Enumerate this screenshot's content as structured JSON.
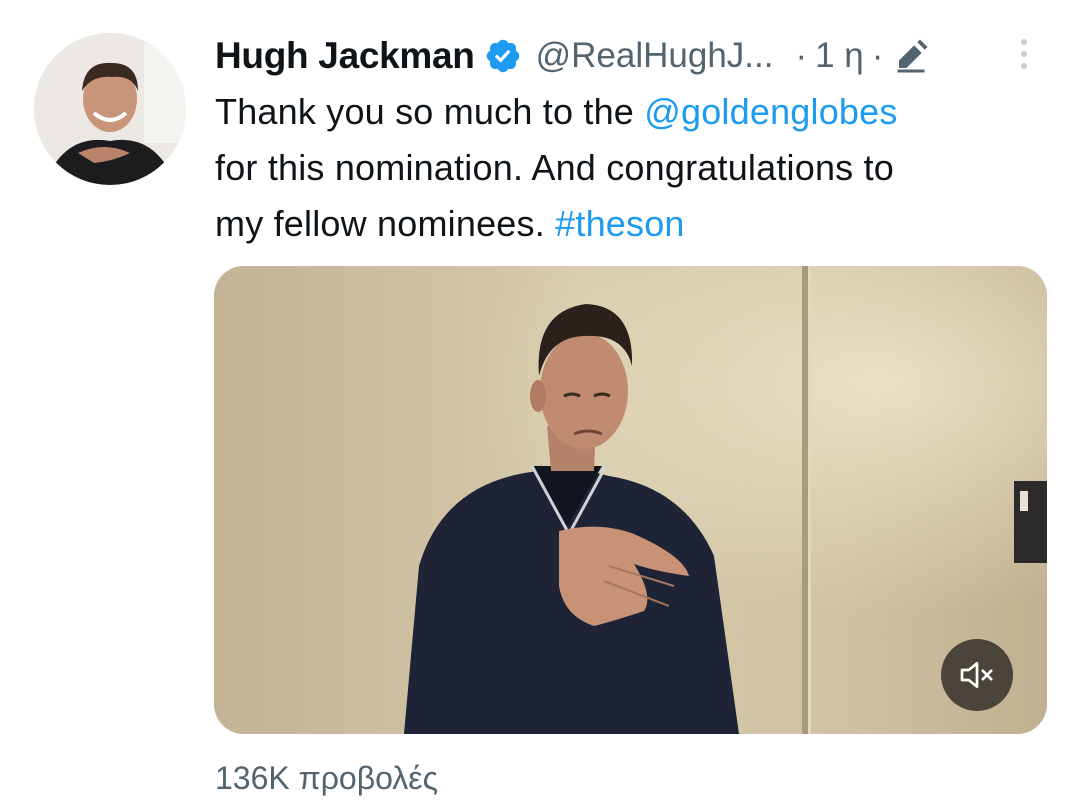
{
  "tweet": {
    "author_name": "Hugh Jackman",
    "handle": "@RealHughJ...",
    "separator": "·",
    "time": "1 η",
    "text_lines": [
      {
        "before": "Thank you so much to the ",
        "link": "@goldenglobes",
        "after": ""
      },
      {
        "before": "for this nomination. And congratulations to",
        "link": "",
        "after": ""
      },
      {
        "before": "my fellow nominees. ",
        "link": "#theson",
        "after": ""
      }
    ],
    "views": "136K προβολές"
  },
  "colors": {
    "link": "#1d9bf0",
    "secondary_text": "#536471",
    "verified_badge": "#1d9bf0"
  },
  "icons": {
    "verified": "verified-badge-icon",
    "edited": "edit-pencil-icon",
    "more": "more-vertical-icon",
    "mute": "volume-muted-icon"
  }
}
